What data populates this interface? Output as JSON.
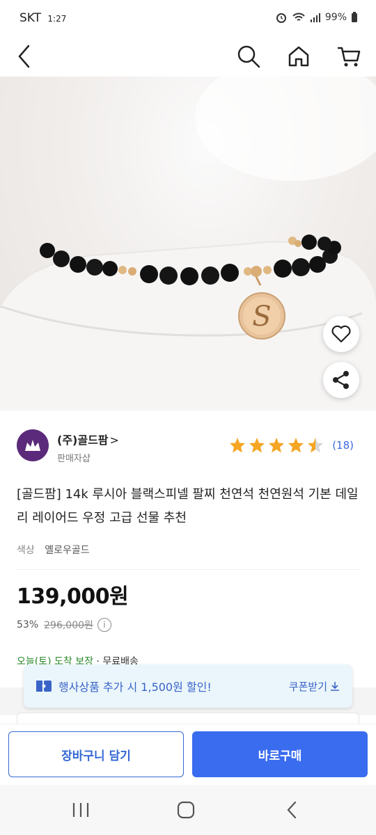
{
  "status": {
    "carrier": "SKT",
    "time": "1:27",
    "battery": "99%"
  },
  "nav": {
    "back_icon": "back-arrow-icon",
    "search_icon": "search-icon",
    "home_icon": "home-icon",
    "cart_icon": "cart-icon"
  },
  "seller": {
    "name": "(주)골드팜",
    "chevron": ">",
    "type": "판매자샵"
  },
  "rating": {
    "stars": 4.5,
    "count": "(18)"
  },
  "product": {
    "title": "[골드팜] 14k 루시아 블랙스피넬 팔찌 천연석 천연원석 기본 데일리 레이어드 우정 고급 선물 추천",
    "color_label": "색상",
    "color_value": "옐로우골드",
    "price": "139,000원",
    "discount_rate": "53%",
    "original_price": "296,000원",
    "delivery_arrival": "오늘(토) 도착 보장",
    "delivery_free": " · 무료배송"
  },
  "coupon": {
    "text": "행사상품 추가 시 1,500원 할인!",
    "button": "쿠폰받기"
  },
  "actions": {
    "cart": "장바구니 담기",
    "buy": "바로구매"
  },
  "colors": {
    "accent": "#3a6cf0",
    "star": "#f5a623",
    "seller_logo": "#5b2a7a"
  }
}
